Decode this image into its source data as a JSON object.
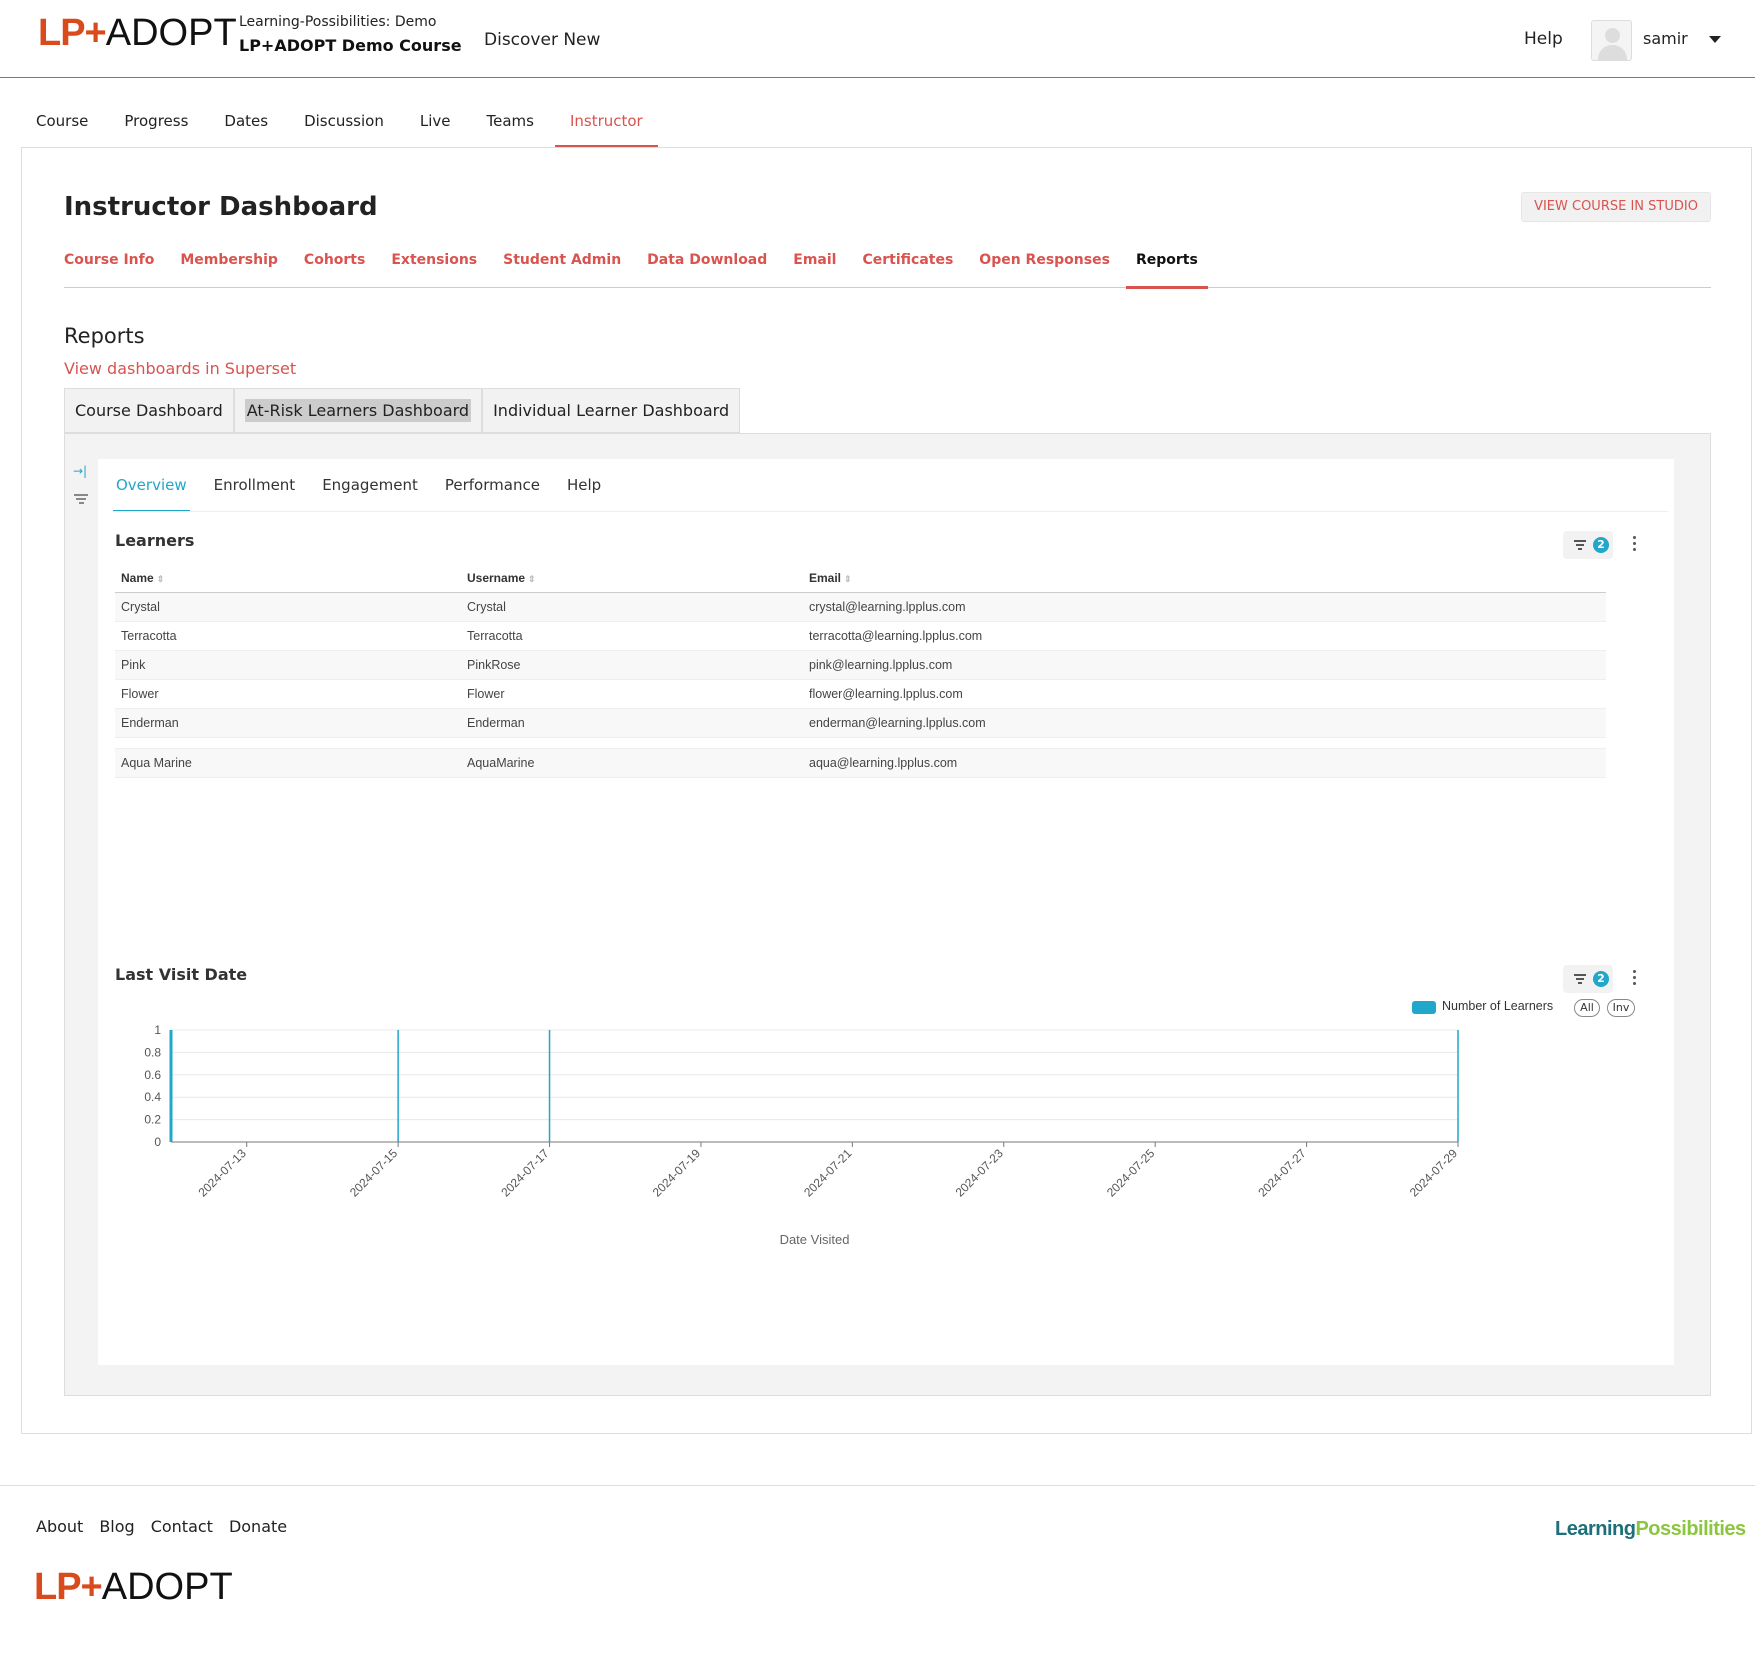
{
  "header": {
    "logo_lp": "LP+",
    "logo_adopt": "ADOPT",
    "org": "Learning-Possibilities: Demo",
    "course_name": "LP+ADOPT Demo Course",
    "discover": "Discover New",
    "help": "Help",
    "username": "samir"
  },
  "course_nav": [
    "Course",
    "Progress",
    "Dates",
    "Discussion",
    "Live",
    "Teams",
    "Instructor"
  ],
  "course_nav_active": "Instructor",
  "dashboard": {
    "title": "Instructor Dashboard",
    "studio_button": "VIEW COURSE IN STUDIO",
    "tabs": [
      "Course Info",
      "Membership",
      "Cohorts",
      "Extensions",
      "Student Admin",
      "Data Download",
      "Email",
      "Certificates",
      "Open Responses",
      "Reports"
    ],
    "active_tab": "Reports"
  },
  "reports": {
    "title": "Reports",
    "superset_link": "View dashboards in Superset",
    "dashboard_tabs": [
      "Course Dashboard",
      "At-Risk Learners Dashboard",
      "Individual Learner Dashboard"
    ],
    "active_dashboard": "At-Risk Learners Dashboard"
  },
  "superset": {
    "tabs": [
      "Overview",
      "Enrollment",
      "Engagement",
      "Performance",
      "Help"
    ],
    "active_tab": "Overview",
    "learners": {
      "title": "Learners",
      "filter_count": "2",
      "columns": [
        "Name",
        "Username",
        "Email"
      ],
      "rows": [
        [
          "Crystal",
          "Crystal",
          "crystal@learning.lpplus.com"
        ],
        [
          "Terracotta",
          "Terracotta",
          "terracotta@learning.lpplus.com"
        ],
        [
          "Pink",
          "PinkRose",
          "pink@learning.lpplus.com"
        ],
        [
          "Flower",
          "Flower",
          "flower@learning.lpplus.com"
        ],
        [
          "Enderman",
          "Enderman",
          "enderman@learning.lpplus.com"
        ],
        [
          "Aqua Marine",
          "AquaMarine",
          "aqua@learning.lpplus.com"
        ]
      ]
    },
    "last_visit": {
      "title": "Last Visit Date",
      "filter_count": "2",
      "legend_all": "All",
      "legend_inv": "Inv"
    }
  },
  "chart_data": {
    "type": "bar",
    "title": "Last Visit Date",
    "xlabel": "Date Visited",
    "ylabel": "",
    "ylim": [
      0,
      1
    ],
    "yticks": [
      0,
      0.2,
      0.4,
      0.6,
      0.8,
      1
    ],
    "x_range": [
      "2024-07-12",
      "2024-07-29"
    ],
    "xticks": [
      "2024-07-13",
      "2024-07-15",
      "2024-07-17",
      "2024-07-19",
      "2024-07-21",
      "2024-07-23",
      "2024-07-25",
      "2024-07-27",
      "2024-07-29"
    ],
    "series": [
      {
        "name": "Number of Learners",
        "color": "#20a7c9",
        "points": [
          {
            "x": "2024-07-12",
            "y": 1
          },
          {
            "x": "2024-07-15",
            "y": 1
          },
          {
            "x": "2024-07-17",
            "y": 1
          },
          {
            "x": "2024-07-29",
            "y": 1
          }
        ]
      }
    ],
    "legend": "top-right",
    "grid": true
  },
  "footer": {
    "links": [
      "About",
      "Blog",
      "Contact",
      "Donate"
    ],
    "logo_lp": "LP+",
    "logo_adopt": "ADOPT",
    "brand_part1": "Learning",
    "brand_part2": "Possibilities"
  },
  "colors": {
    "accent": "#d9534f",
    "superset_blue": "#20a7c9"
  }
}
